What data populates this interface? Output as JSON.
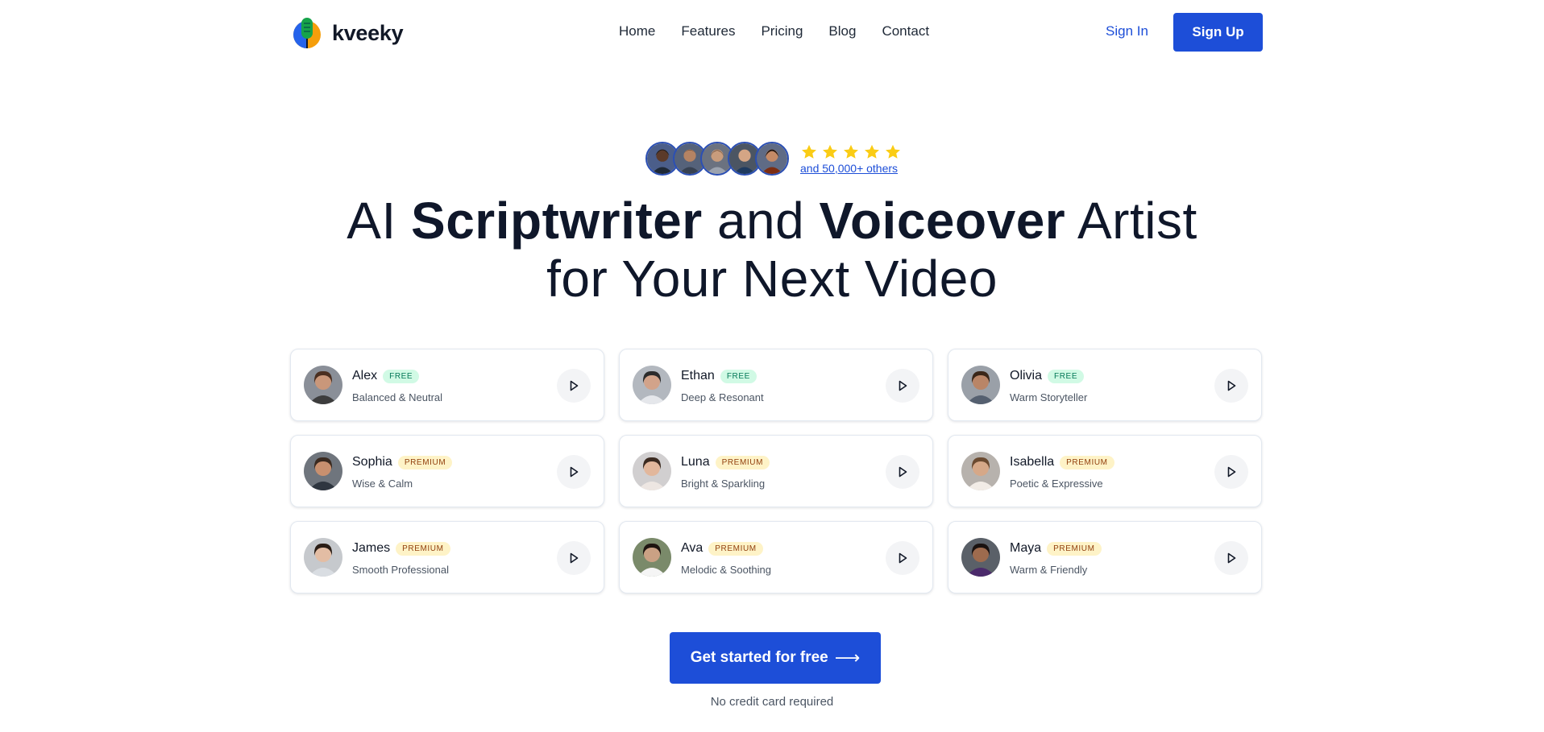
{
  "brand": {
    "name": "kveeky",
    "icon": "microphone-logo-icon"
  },
  "nav": {
    "items": [
      "Home",
      "Features",
      "Pricing",
      "Blog",
      "Contact"
    ]
  },
  "auth": {
    "sign_in": "Sign In",
    "sign_up": "Sign Up"
  },
  "social_proof": {
    "rating": 5,
    "others": "and 50,000+ others",
    "star_color": "#facc15"
  },
  "hero": {
    "line1": [
      {
        "text": "AI ",
        "bold": false
      },
      {
        "text": "Scriptwriter",
        "bold": true
      },
      {
        "text": " and ",
        "bold": false
      },
      {
        "text": "Voiceover",
        "bold": true
      },
      {
        "text": " Artist",
        "bold": false
      }
    ],
    "line2": "for Your Next Video"
  },
  "voices": [
    {
      "name": "Alex",
      "tier": "FREE",
      "tier_type": "free",
      "description": "Balanced & Neutral"
    },
    {
      "name": "Ethan",
      "tier": "FREE",
      "tier_type": "free",
      "description": "Deep & Resonant"
    },
    {
      "name": "Olivia",
      "tier": "FREE",
      "tier_type": "free",
      "description": "Warm Storyteller"
    },
    {
      "name": "Sophia",
      "tier": "PREMIUM",
      "tier_type": "premium",
      "description": "Wise & Calm"
    },
    {
      "name": "Luna",
      "tier": "PREMIUM",
      "tier_type": "premium",
      "description": "Bright & Sparkling"
    },
    {
      "name": "Isabella",
      "tier": "PREMIUM",
      "tier_type": "premium",
      "description": "Poetic & Expressive"
    },
    {
      "name": "James",
      "tier": "PREMIUM",
      "tier_type": "premium",
      "description": "Smooth Professional"
    },
    {
      "name": "Ava",
      "tier": "PREMIUM",
      "tier_type": "premium",
      "description": "Melodic & Soothing"
    },
    {
      "name": "Maya",
      "tier": "PREMIUM",
      "tier_type": "premium",
      "description": "Warm & Friendly"
    }
  ],
  "cta": {
    "label": "Get started for free",
    "arrow": "⟶",
    "note": "No credit card required"
  },
  "colors": {
    "accent": "#1d4ed8",
    "free_badge": "#d1fae5",
    "premium_badge": "#fef3c7"
  }
}
